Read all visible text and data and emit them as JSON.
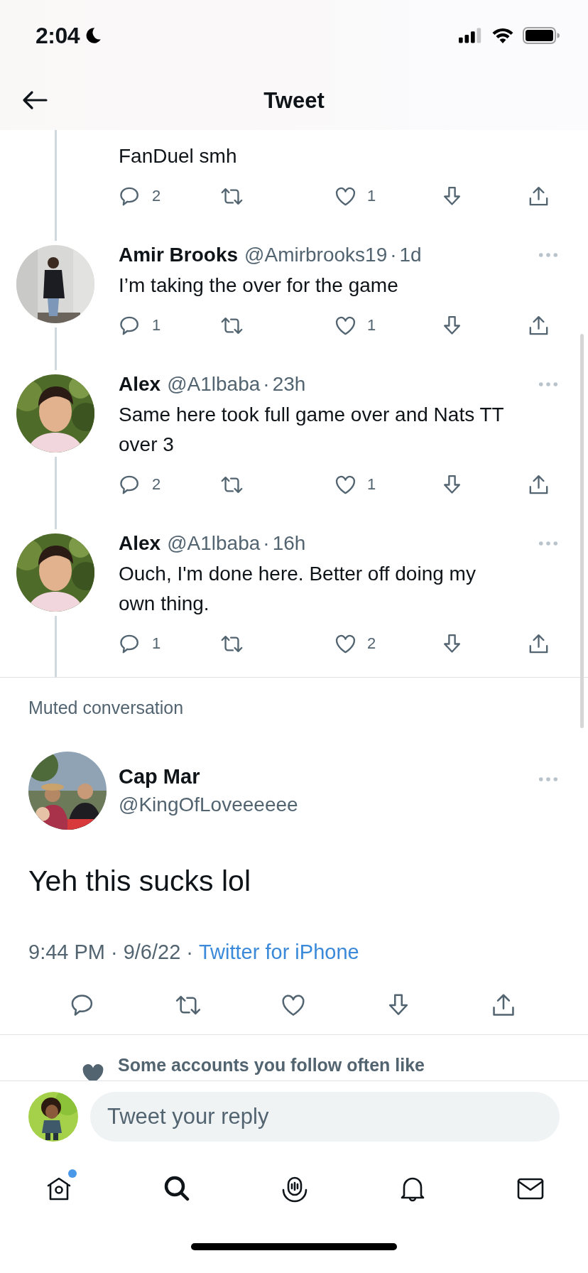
{
  "status_bar": {
    "time": "2:04"
  },
  "header": {
    "title": "Tweet"
  },
  "separator": "·",
  "replies": [
    {
      "text": "FanDuel smh",
      "reply_count": "2",
      "like_count": "1"
    },
    {
      "name": "Amir Brooks",
      "handle": "@Amirbrooks19",
      "time": "1d",
      "text": "I’m taking the over for the game",
      "reply_count": "1",
      "like_count": "1"
    },
    {
      "name": "Alex",
      "handle": "@A1lbaba",
      "time": "23h",
      "text": "Same here took full game over and Nats TT over 3",
      "reply_count": "2",
      "like_count": "1"
    },
    {
      "name": "Alex",
      "handle": "@A1lbaba",
      "time": "16h",
      "text": "Ouch, I'm done here. Better off doing my own thing.",
      "reply_count": "1",
      "like_count": "2"
    }
  ],
  "muted_label": "Muted conversation",
  "main_tweet": {
    "name": "Cap Mar",
    "handle": "@KingOfLoveeeeee",
    "text": "Yeh this sucks lol",
    "time": "9:44 PM",
    "date": "9/6/22",
    "source": "Twitter for iPhone"
  },
  "social_context": "Some accounts you follow often like",
  "reply_bar": {
    "placeholder": "Tweet your reply"
  },
  "tabs": [
    {
      "kind": "home",
      "selected": false,
      "badge": true
    },
    {
      "kind": "search",
      "selected": true,
      "badge": false
    },
    {
      "kind": "spaces",
      "selected": false,
      "badge": false
    },
    {
      "kind": "notifications",
      "selected": false,
      "badge": false
    },
    {
      "kind": "messages",
      "selected": false,
      "badge": false
    }
  ]
}
